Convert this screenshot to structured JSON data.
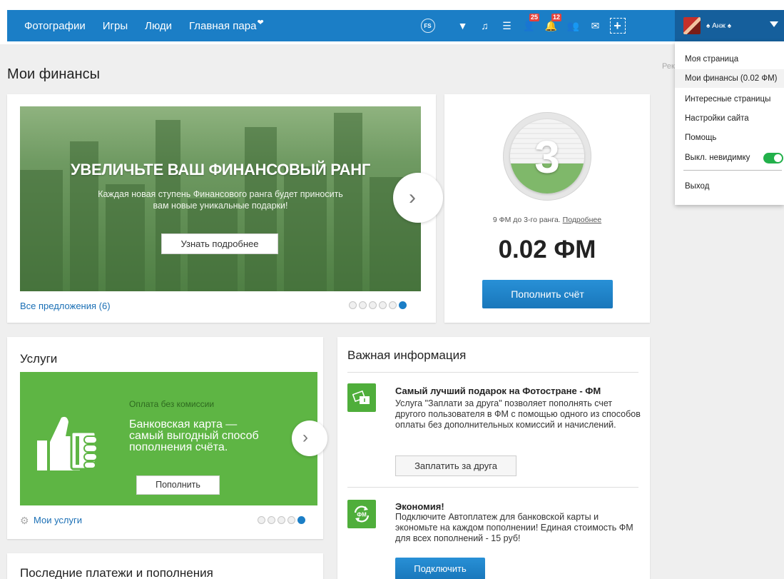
{
  "nav": {
    "links": [
      "Фотографии",
      "Игры",
      "Люди",
      "Главная пара"
    ],
    "fs_badge": "FS",
    "counts": {
      "friends": "25",
      "events": "12"
    },
    "user_name": "♠ Анж ♠"
  },
  "page": {
    "title": "Мои финансы",
    "ad_label": "Рек"
  },
  "promo": {
    "title": "УВЕЛИЧЬТЕ ВАШ ФИНАНСОВЫЙ РАНГ",
    "subtitle": "Каждая новая ступень Финансового ранга будет приносить вам новые уникальные подарки!",
    "button": "Узнать подробнее",
    "offers_link": "Все предложения (6)",
    "slide_count": 6,
    "active_slide": 6
  },
  "balance": {
    "rank": "3",
    "rank_progress": 0.4,
    "note": "9 ФМ до 3-го ранга.",
    "note_link": "Подробнее",
    "amount": "0.02 ФМ",
    "topup_button": "Пополнить счёт"
  },
  "services": {
    "title": "Услуги",
    "small_text": "Оплата без комиссии",
    "big_text": "Банковская карта — самый выгодный способ пополнения счёта.",
    "button": "Пополнить",
    "my_services_link": "Мои услуги",
    "slide_count": 5,
    "active_slide": 5
  },
  "info": {
    "title": "Важная информация",
    "items": [
      {
        "heading": "Самый лучший подарок на Фотостране - ФМ",
        "body": "Услуга \"Заплати за друга\" позволяет пополнять счет другого пользователя в ФМ с помощью одного из способов оплаты без дополнительных комиссий и начислений.",
        "button": "Заплатить за друга"
      },
      {
        "heading": "Экономия!",
        "body": "Подключите Автоплатеж для банковской карты и экономьте на каждом пополнении! Единая стоимость ФМ для всех пополнений - 15 руб!",
        "button": "Подключить",
        "icon_text": "ФМ"
      }
    ]
  },
  "payments": {
    "title": "Последние платежи и пополнения"
  },
  "dropdown": {
    "items": [
      "Моя страница",
      "Мои финансы (0.02 ФМ)",
      "Интересные страницы",
      "Настройки сайта",
      "Помощь",
      "Выкл. невидимку",
      "Выход"
    ],
    "invisible_enabled": true
  },
  "colors": {
    "nav_blue": "#1b7ec6",
    "user_zone": "#155f9c",
    "green": "#5eb544",
    "button_blue": "#1977bb",
    "badge_red": "#e4423b"
  }
}
